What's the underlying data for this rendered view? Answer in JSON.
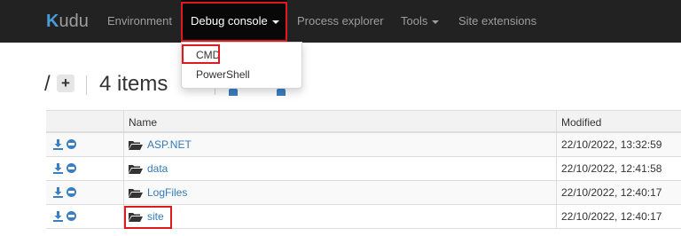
{
  "navbar": {
    "brand": "udu",
    "brand_letter": "K",
    "items": [
      {
        "label": "Environment"
      },
      {
        "label": "Debug console"
      },
      {
        "label": "Process explorer"
      },
      {
        "label": "Tools"
      },
      {
        "label": "Site extensions"
      }
    ]
  },
  "dropdown": {
    "items": [
      {
        "label": "CMD"
      },
      {
        "label": "PowerShell"
      }
    ]
  },
  "heading": {
    "path": "/",
    "add_label": "+",
    "items_count": "4 items"
  },
  "table": {
    "columns": {
      "name": "Name",
      "modified": "Modified"
    },
    "rows": [
      {
        "name": "ASP.NET",
        "modified": "22/10/2022, 13:32:59"
      },
      {
        "name": "data",
        "modified": "22/10/2022, 12:41:58"
      },
      {
        "name": "LogFiles",
        "modified": "22/10/2022, 12:40:17"
      },
      {
        "name": "site",
        "modified": "22/10/2022, 12:40:17"
      }
    ]
  },
  "icons": {
    "download": "download-icon",
    "remove": "remove-icon",
    "folder": "folder-open-icon",
    "add": "plus-icon"
  },
  "colors": {
    "navbar_bg": "#222222",
    "nav_active_bg": "#080808",
    "link": "#337ab7",
    "icon_blue": "#3a7fc1",
    "highlight": "#e0191f"
  }
}
